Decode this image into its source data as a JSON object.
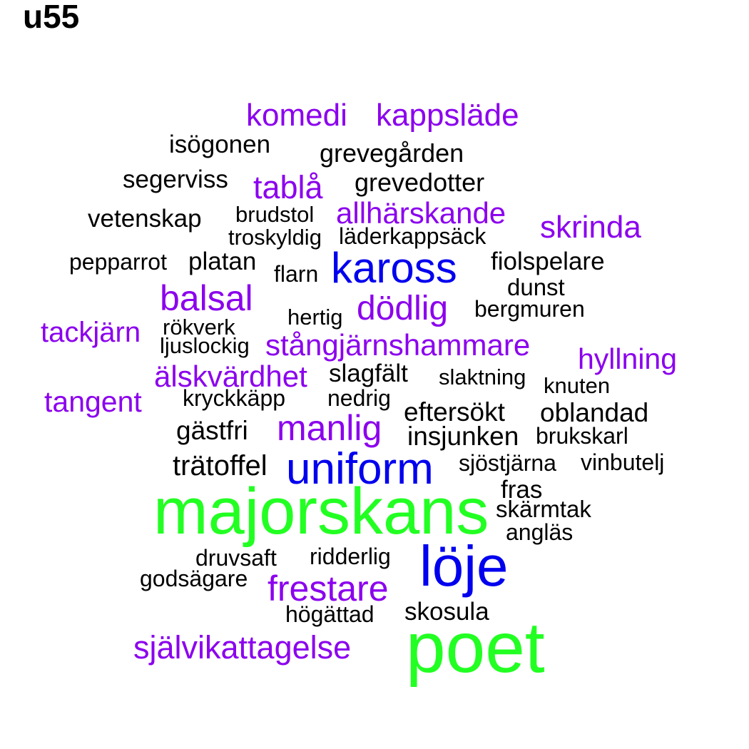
{
  "title": "u55",
  "colors": {
    "black": "#000000",
    "purple": "#8b00ee",
    "blue": "#0000ee",
    "green": "#22ff22"
  },
  "words": [
    {
      "text": "komedi",
      "color": "purple"
    },
    {
      "text": "kappsläde",
      "color": "purple"
    },
    {
      "text": "isögonen",
      "color": "black"
    },
    {
      "text": "grevegården",
      "color": "black"
    },
    {
      "text": "segerviss",
      "color": "black"
    },
    {
      "text": "tablå",
      "color": "purple"
    },
    {
      "text": "grevedotter",
      "color": "black"
    },
    {
      "text": "vetenskap",
      "color": "black"
    },
    {
      "text": "brudstol",
      "color": "black"
    },
    {
      "text": "allhärskande",
      "color": "purple"
    },
    {
      "text": "skrinda",
      "color": "purple"
    },
    {
      "text": "troskyldig",
      "color": "black"
    },
    {
      "text": "läderkappsäck",
      "color": "black"
    },
    {
      "text": "pepparrot",
      "color": "black"
    },
    {
      "text": "platan",
      "color": "black"
    },
    {
      "text": "flarn",
      "color": "black"
    },
    {
      "text": "kaross",
      "color": "blue"
    },
    {
      "text": "fiolspelare",
      "color": "black"
    },
    {
      "text": "dunst",
      "color": "black"
    },
    {
      "text": "balsal",
      "color": "purple"
    },
    {
      "text": "dödlig",
      "color": "purple"
    },
    {
      "text": "hertig",
      "color": "black"
    },
    {
      "text": "bergmuren",
      "color": "black"
    },
    {
      "text": "tackjärn",
      "color": "purple"
    },
    {
      "text": "rökverk",
      "color": "black"
    },
    {
      "text": "ljuslockig",
      "color": "black"
    },
    {
      "text": "stångjärnshammare",
      "color": "purple"
    },
    {
      "text": "hyllning",
      "color": "purple"
    },
    {
      "text": "älskvärdhet",
      "color": "purple"
    },
    {
      "text": "slagfält",
      "color": "black"
    },
    {
      "text": "slaktning",
      "color": "black"
    },
    {
      "text": "knuten",
      "color": "black"
    },
    {
      "text": "tangent",
      "color": "purple"
    },
    {
      "text": "kryckkäpp",
      "color": "black"
    },
    {
      "text": "nedrig",
      "color": "black"
    },
    {
      "text": "eftersökt",
      "color": "black"
    },
    {
      "text": "oblandad",
      "color": "black"
    },
    {
      "text": "gästfri",
      "color": "black"
    },
    {
      "text": "manlig",
      "color": "purple"
    },
    {
      "text": "insjunken",
      "color": "black"
    },
    {
      "text": "brukskarl",
      "color": "black"
    },
    {
      "text": "trätoffel",
      "color": "black"
    },
    {
      "text": "uniform",
      "color": "blue"
    },
    {
      "text": "sjöstjärna",
      "color": "black"
    },
    {
      "text": "vinbutelj",
      "color": "black"
    },
    {
      "text": "fras",
      "color": "black"
    },
    {
      "text": "majorskans",
      "color": "green"
    },
    {
      "text": "skärmtak",
      "color": "black"
    },
    {
      "text": "angläs",
      "color": "black"
    },
    {
      "text": "druvsaft",
      "color": "black"
    },
    {
      "text": "ridderlig",
      "color": "black"
    },
    {
      "text": "löje",
      "color": "blue"
    },
    {
      "text": "godsägare",
      "color": "black"
    },
    {
      "text": "frestare",
      "color": "purple"
    },
    {
      "text": "högättad",
      "color": "black"
    },
    {
      "text": "skosula",
      "color": "black"
    },
    {
      "text": "självikattagelse",
      "color": "purple"
    },
    {
      "text": "poet",
      "color": "green"
    }
  ]
}
